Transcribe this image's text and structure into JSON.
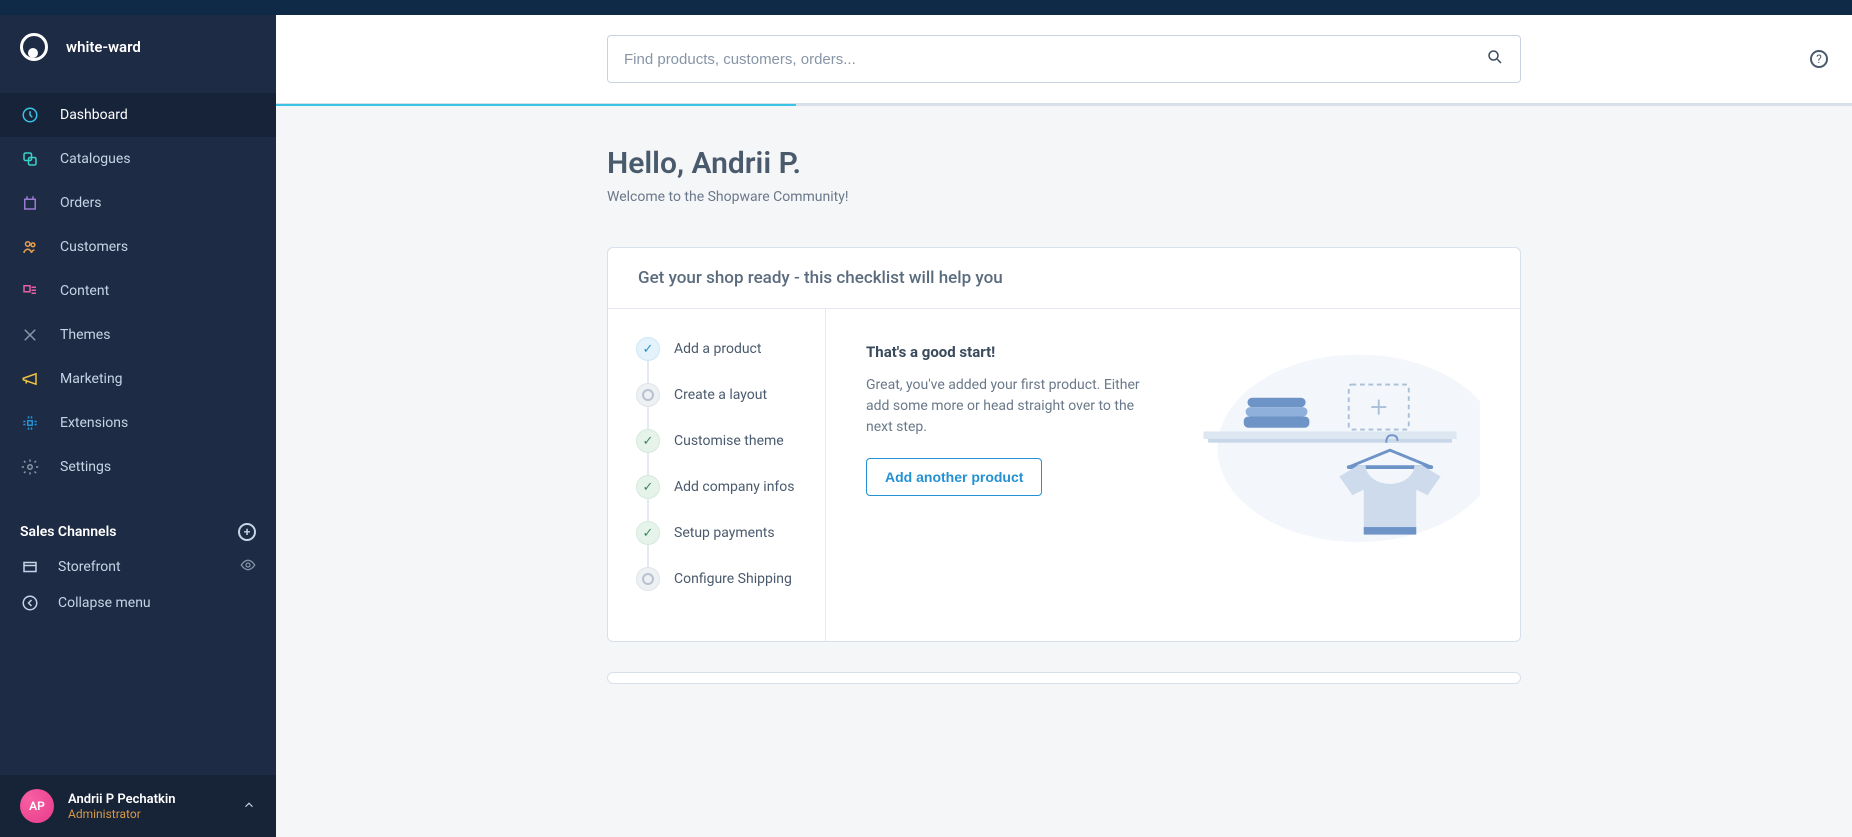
{
  "header": {
    "shop_name": "white-ward"
  },
  "sidebar": {
    "items": [
      {
        "label": "Dashboard",
        "icon": "dashboard",
        "active": true
      },
      {
        "label": "Catalogues",
        "icon": "catalogues",
        "active": false
      },
      {
        "label": "Orders",
        "icon": "orders",
        "active": false
      },
      {
        "label": "Customers",
        "icon": "customers",
        "active": false
      },
      {
        "label": "Content",
        "icon": "content",
        "active": false
      },
      {
        "label": "Themes",
        "icon": "themes",
        "active": false
      },
      {
        "label": "Marketing",
        "icon": "marketing",
        "active": false
      },
      {
        "label": "Extensions",
        "icon": "extensions",
        "active": false
      },
      {
        "label": "Settings",
        "icon": "settings",
        "active": false
      }
    ],
    "sales_channels_title": "Sales Channels",
    "channels": [
      {
        "label": "Storefront"
      }
    ],
    "collapse_label": "Collapse menu"
  },
  "user": {
    "initials": "AP",
    "name": "Andrii P Pechatkin",
    "role": "Administrator"
  },
  "search": {
    "placeholder": "Find products, customers, orders..."
  },
  "greeting": {
    "title": "Hello, Andrii P.",
    "subtitle": "Welcome to the Shopware Community!"
  },
  "checklist": {
    "title": "Get your shop ready - this checklist will help you",
    "items": [
      {
        "label": "Add a product",
        "state": "current"
      },
      {
        "label": "Create a layout",
        "state": "pending"
      },
      {
        "label": "Customise theme",
        "state": "done"
      },
      {
        "label": "Add company infos",
        "state": "done"
      },
      {
        "label": "Setup payments",
        "state": "done"
      },
      {
        "label": "Configure Shipping",
        "state": "pending"
      }
    ]
  },
  "detail": {
    "heading": "That's a good start!",
    "body": "Great, you've added your first product. Either add some more or head straight over to the next step.",
    "button": "Add another product"
  },
  "colors": {
    "accent": "#2491d4",
    "sidebar": "#1d2b45"
  }
}
